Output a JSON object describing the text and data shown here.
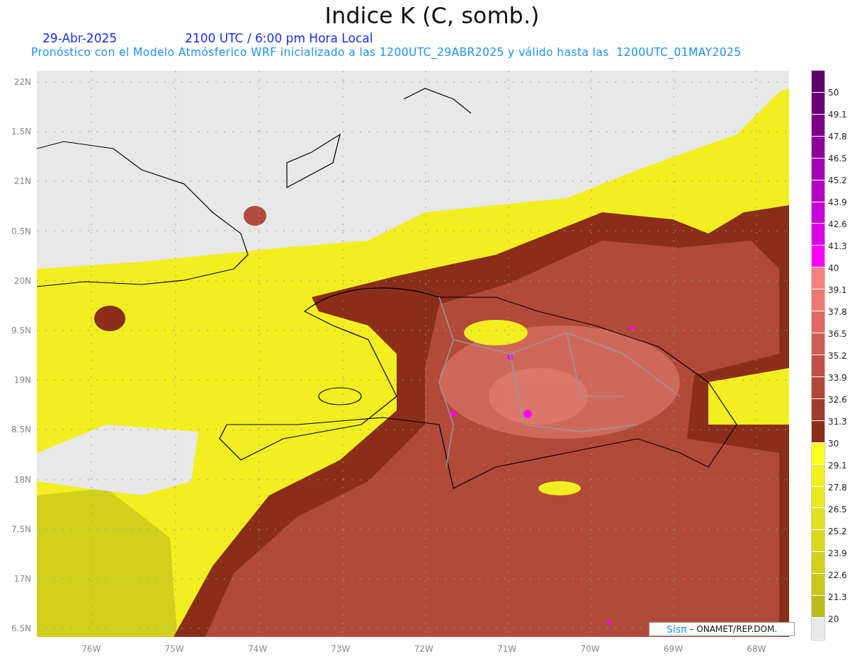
{
  "title": "Indice K (C, somb.)",
  "date": "29-Abr-2025",
  "time": "2100 UTC / 6:00 pm Hora Local",
  "subtitle": "Pronóstico con el Modelo Atmósferico WRF inicializado a las 1200UTC_29ABR2025 y válido hasta las  1200UTC_01MAY2025",
  "y_axis": [
    "22N",
    "1.5N",
    "21N",
    "0.5N",
    "20N",
    "9.5N",
    "19N",
    "8.5N",
    "18N",
    "7.5N",
    "17N",
    "6.5N"
  ],
  "x_axis": [
    "76W",
    "75W",
    "74W",
    "73W",
    "72W",
    "71W",
    "70W",
    "69W",
    "68W"
  ],
  "logo": {
    "mark": "Sisπ",
    "text": "– ONAMET/REP.DOM."
  },
  "colorbar": {
    "bands": [
      {
        "color": "#5c006a"
      },
      {
        "color": "#6a0078"
      },
      {
        "color": "#7a0088"
      },
      {
        "color": "#8c0098"
      },
      {
        "color": "#a000b0"
      },
      {
        "color": "#b400c4"
      },
      {
        "color": "#c800d8"
      },
      {
        "color": "#dc00e8"
      },
      {
        "color": "#ff00ff"
      },
      {
        "color": "#f88080"
      },
      {
        "color": "#ec7872"
      },
      {
        "color": "#de6a62"
      },
      {
        "color": "#d05e54"
      },
      {
        "color": "#c05048"
      },
      {
        "color": "#b04838"
      },
      {
        "color": "#a03c2c"
      },
      {
        "color": "#8a2e1a"
      },
      {
        "color": "#ffff20"
      },
      {
        "color": "#f4f020"
      },
      {
        "color": "#ece820"
      },
      {
        "color": "#e2e020"
      },
      {
        "color": "#dad81e"
      },
      {
        "color": "#d2d01c"
      },
      {
        "color": "#c8c81a"
      },
      {
        "color": "#bcbc18"
      },
      {
        "color": "#e8e8e8"
      }
    ],
    "labels": [
      "50",
      "49.1",
      "47.8",
      "46.5",
      "45.2",
      "43.9",
      "42.6",
      "41.3",
      "40",
      "39.1",
      "37.8",
      "36.5",
      "35.2",
      "33.9",
      "32.6",
      "31.3",
      "30",
      "29.1",
      "27.8",
      "26.5",
      "25.2",
      "23.9",
      "22.6",
      "21.3",
      "20"
    ]
  }
}
